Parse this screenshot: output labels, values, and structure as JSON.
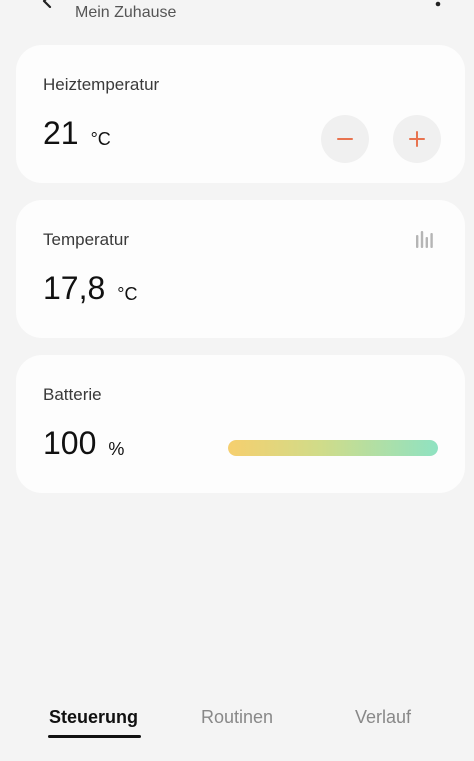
{
  "header": {
    "subtitle": "Mein Zuhause",
    "back_icon": "chevron-left-icon",
    "more_icon": "more-vertical-icon"
  },
  "heating": {
    "label": "Heiztemperatur",
    "value": "21",
    "unit": "°C",
    "minus_icon": "minus-icon",
    "plus_icon": "plus-icon",
    "accent_color": "#e8734f"
  },
  "temperature": {
    "label": "Temperatur",
    "value": "17,8",
    "unit": "°C",
    "chart_icon": "bar-chart-icon"
  },
  "battery": {
    "label": "Batterie",
    "value": "100",
    "unit": "%",
    "level_percent": 100,
    "gradient_colors": [
      "#f6cf6e",
      "#8fe2c2"
    ]
  },
  "tabs": [
    {
      "label": "Steuerung",
      "active": true
    },
    {
      "label": "Routinen",
      "active": false
    },
    {
      "label": "Verlauf",
      "active": false
    }
  ]
}
